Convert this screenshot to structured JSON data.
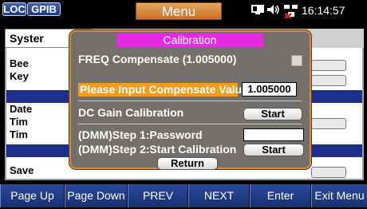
{
  "status": {
    "loc": "LOC",
    "gpib": "GPIB",
    "menu_title": "Menu",
    "time": "16:14:57",
    "icons": [
      "monitor-icon",
      "speaker-icon",
      "network-disconnected-icon"
    ]
  },
  "background": {
    "tab_label": "Syster",
    "items": [
      "Bee",
      "Key",
      "Date",
      "Tim",
      "Tim",
      "Save"
    ]
  },
  "dialog": {
    "title": "Calibration",
    "freq_comp_label": "FREQ Compensate (1.005000)",
    "input_label": "Please Input Compensate Value",
    "input_value": "1.005000",
    "dc_gain_label": "DC Gain Calibration",
    "dc_gain_button": "Start",
    "dmm_step1": "(DMM)Step 1:Password",
    "dmm_step2": "(DMM)Step 2:Start Calibration",
    "dmm_start_button": "Start",
    "return_button": "Return"
  },
  "softkeys": [
    "Page Up",
    "Page Down",
    "PREV",
    "NEXT",
    "Enter",
    "Exit Menu"
  ],
  "colors": {
    "title_bar": "#e52be2",
    "highlight": "#f39b1a",
    "softkey": "#1f3a86",
    "dialog_bg": "#73706c"
  }
}
